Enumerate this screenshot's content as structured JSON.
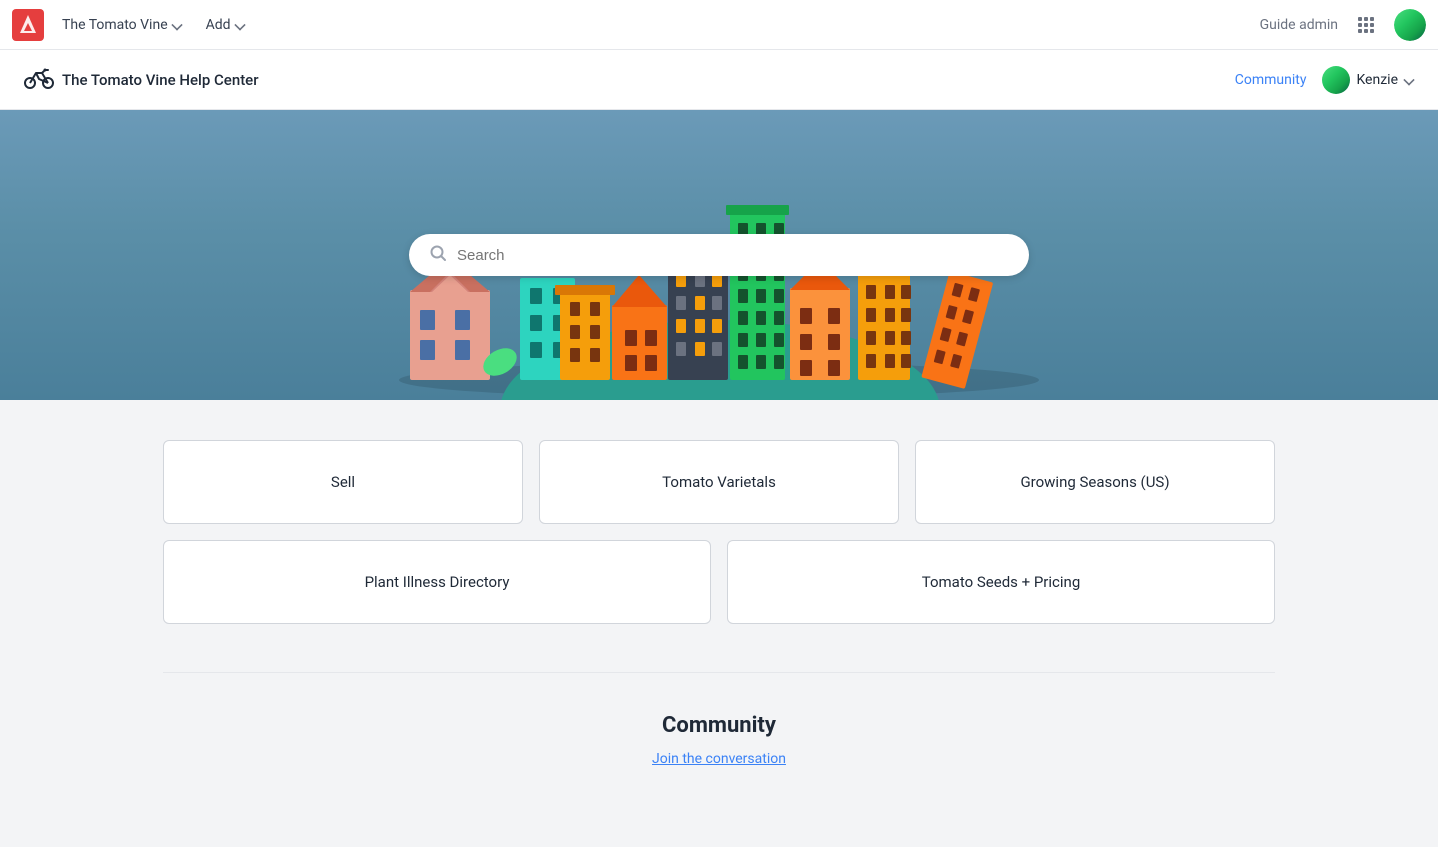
{
  "admin_bar": {
    "brand_name": "The Tomato Vine",
    "nav_items": [
      {
        "label": "The Tomato Vine",
        "has_chevron": true
      },
      {
        "label": "Add",
        "has_chevron": true
      }
    ],
    "guide_admin_label": "Guide admin",
    "grid_icon_label": "grid-icon",
    "avatar_alt": "user avatar"
  },
  "help_header": {
    "logo_alt": "bike-logo",
    "title": "The Tomato Vine Help Center",
    "community_label": "Community",
    "user_name": "Kenzie",
    "user_chevron": true
  },
  "hero": {
    "search_placeholder": "Search"
  },
  "categories": {
    "top_row": [
      {
        "label": "Sell"
      },
      {
        "label": "Tomato Varietals"
      },
      {
        "label": "Growing Seasons (US)"
      }
    ],
    "bottom_row": [
      {
        "label": "Plant Illness Directory"
      },
      {
        "label": "Tomato Seeds + Pricing"
      }
    ]
  },
  "community": {
    "title": "Community",
    "link_label": "Join the conversation"
  }
}
